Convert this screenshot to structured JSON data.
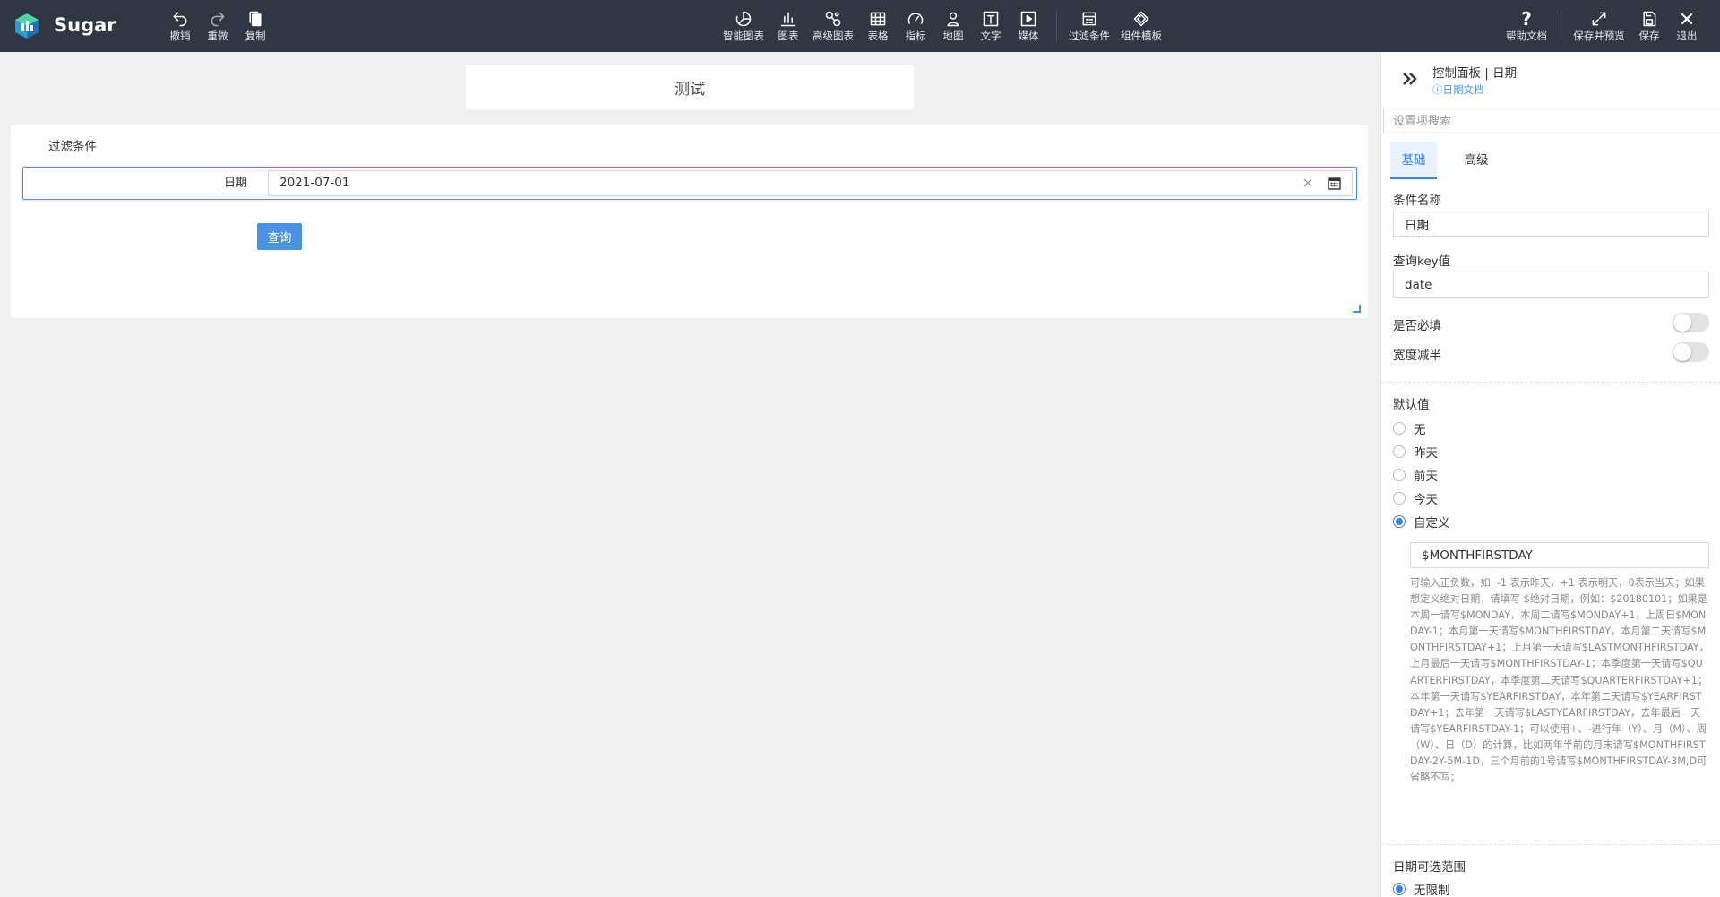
{
  "app": {
    "name": "Sugar"
  },
  "toolbar": {
    "left": [
      {
        "id": "undo",
        "label": "撤销",
        "icon": "undo-icon"
      },
      {
        "id": "redo",
        "label": "重做",
        "icon": "redo-icon"
      },
      {
        "id": "copy",
        "label": "复制",
        "icon": "copy-icon"
      }
    ],
    "center": [
      {
        "id": "smart-chart",
        "label": "智能图表",
        "icon": "smart-chart-icon"
      },
      {
        "id": "chart",
        "label": "图表",
        "icon": "bar-chart-icon"
      },
      {
        "id": "advanced-chart",
        "label": "高级图表",
        "icon": "advanced-chart-icon"
      },
      {
        "id": "table",
        "label": "表格",
        "icon": "table-icon"
      },
      {
        "id": "metric",
        "label": "指标",
        "icon": "gauge-icon"
      },
      {
        "id": "map",
        "label": "地图",
        "icon": "map-pin-icon"
      },
      {
        "id": "text",
        "label": "文字",
        "icon": "text-icon"
      },
      {
        "id": "media",
        "label": "媒体",
        "icon": "media-icon"
      },
      {
        "id": "filter",
        "label": "过滤条件",
        "icon": "filter-form-icon"
      },
      {
        "id": "template",
        "label": "组件模板",
        "icon": "component-template-icon"
      }
    ],
    "right": [
      {
        "id": "help",
        "label": "帮助文档",
        "icon": "question-icon"
      },
      {
        "id": "save-preview",
        "label": "保存并预览",
        "icon": "expand-icon"
      },
      {
        "id": "save",
        "label": "保存",
        "icon": "save-icon"
      },
      {
        "id": "exit",
        "label": "退出",
        "icon": "close-icon"
      }
    ]
  },
  "canvas": {
    "title": "测试",
    "filter": {
      "title": "过滤条件",
      "field_label": "日期",
      "field_value": "2021-07-01",
      "query_button": "查询"
    }
  },
  "panel": {
    "title": "控制面板 | 日期",
    "doc_link": "ⓘ日期文档",
    "search_placeholder": "设置项搜索",
    "tabs": [
      {
        "label": "基础",
        "active": true
      },
      {
        "label": "高级",
        "active": false
      }
    ],
    "condition_name_label": "条件名称",
    "condition_name_value": "日期",
    "query_key_label": "查询key值",
    "query_key_value": "date",
    "required_label": "是否必填",
    "required_on": false,
    "half_width_label": "宽度减半",
    "half_width_on": false,
    "default_label": "默认值",
    "default_options": [
      {
        "label": "无",
        "checked": false
      },
      {
        "label": "昨天",
        "checked": false
      },
      {
        "label": "前天",
        "checked": false
      },
      {
        "label": "今天",
        "checked": false
      },
      {
        "label": "自定义",
        "checked": true
      }
    ],
    "custom_value": "$MONTHFIRSTDAY",
    "help_text": "可输入正负数，如: -1 表示昨天，+1 表示明天，0表示当天；如果想定义绝对日期，请填写 $绝对日期，例如：$20180101；如果是本周一请写$MONDAY，本周二请写$MONDAY+1，上周日$MONDAY-1；本月第一天请写$MONTHFIRSTDAY，本月第二天请写$MONTHFIRSTDAY+1；上月第一天请写$LASTMONTHFIRSTDAY，上月最后一天请写$MONTHFIRSTDAY-1；本季度第一天请写$QUARTERFIRSTDAY，本季度第二天请写$QUARTERFIRSTDAY+1；本年第一天请写$YEARFIRSTDAY，本年第二天请写$YEARFIRSTDAY+1；去年第一天请写$LASTYEARFIRSTDAY，去年最后一天请写$YEARFIRSTDAY-1；可以使用+、-进行年（Y）、月（M）、周（W）、日（D）的计算，比如两年半前的月末请写$MONTHFIRSTDAY-2Y-5M-1D，三个月前的1号请写$MONTHFIRSTDAY-3M,D可省略不写；",
    "range_label": "日期可选范围",
    "range_option": {
      "label": "无限制",
      "checked": true
    }
  },
  "colors": {
    "topbar": "#303742",
    "accent": "#4b90e2",
    "panel_bg": "#ffffff"
  }
}
